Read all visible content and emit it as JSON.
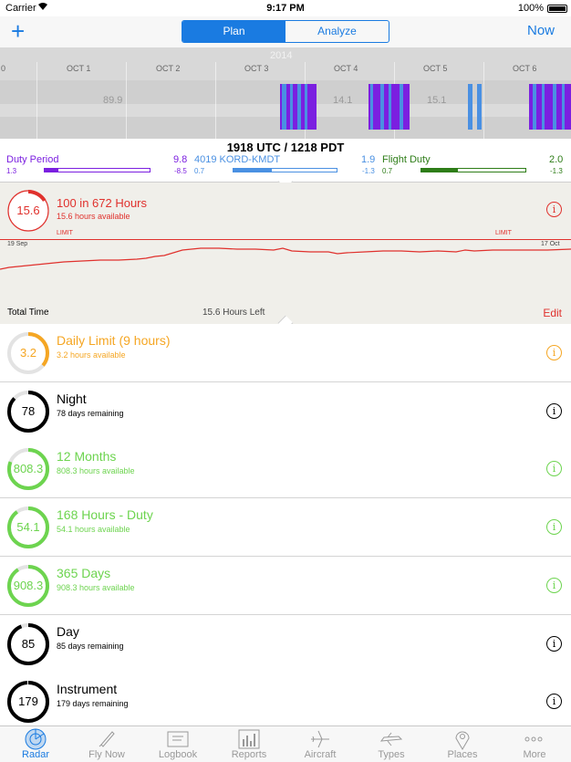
{
  "status_bar": {
    "carrier": "Carrier",
    "time": "9:17 PM",
    "battery": "100%"
  },
  "nav": {
    "segments": [
      "Plan",
      "Analyze"
    ],
    "active_segment": "Plan",
    "right_button": "Now",
    "left_icon": "plus-icon"
  },
  "timeline": {
    "year": "2014",
    "days": [
      "0",
      "OCT 1",
      "OCT 2",
      "OCT 3",
      "OCT 4",
      "OCT 5",
      "OCT 6"
    ],
    "hour_values": [
      "89.9",
      "14.1",
      "15.1"
    ],
    "colors": {
      "duty": "#7b1fe0",
      "flight": "#4a90e2"
    }
  },
  "info": {
    "utc_pdt": "1918 UTC / 1218 PDT",
    "duty_period": {
      "label": "Duty Period",
      "value": "9.8",
      "left": "1.3",
      "delta": "-8.5",
      "progress": 0.13
    },
    "flight": {
      "label": "4019 KORD-KMDT",
      "value": "1.9",
      "left": "0.7",
      "delta": "-1.3",
      "progress": 0.37
    },
    "flight_duty": {
      "label": "Flight Duty",
      "value": "2.0",
      "left": "0.7",
      "delta": "-1.3",
      "progress": 0.35
    }
  },
  "total": {
    "ring_value": "15.6",
    "ring_progress": 0.16,
    "title": "100 in 672 Hours",
    "subtitle": "15.6 hours available",
    "limit_left": "LIMIT",
    "limit_right": "LIMIT",
    "start_date": "19 Sep",
    "end_date": "17 Oct",
    "footer_left": "Total Time",
    "footer_center": "15.6 Hours Left",
    "edit": "Edit",
    "color": "#e0312d"
  },
  "rows": [
    {
      "value": "3.2",
      "title": "Daily Limit (9 hours)",
      "subtitle": "3.2 hours available",
      "color": "#f5a623",
      "progress": 0.36
    },
    {
      "value": "78",
      "title": "Night",
      "subtitle": "78 days remaining",
      "color": "#000000",
      "progress": 0.87
    },
    {
      "value": "808.3",
      "title": "12 Months",
      "subtitle": "808.3 hours available",
      "color": "#6dd44f",
      "progress": 0.81
    },
    {
      "value": "54.1",
      "title": "168 Hours - Duty",
      "subtitle": "54.1 hours available",
      "color": "#6dd44f",
      "progress": 0.9
    },
    {
      "value": "908.3",
      "title": "365 Days",
      "subtitle": "908.3 hours available",
      "color": "#6dd44f",
      "progress": 0.91
    },
    {
      "value": "85",
      "title": "Day",
      "subtitle": "85 days remaining",
      "color": "#000000",
      "progress": 0.94
    },
    {
      "value": "179",
      "title": "Instrument",
      "subtitle": "179 days remaining",
      "color": "#000000",
      "progress": 0.99
    }
  ],
  "tabs": [
    {
      "label": "Radar",
      "icon": "radar-icon",
      "active": true
    },
    {
      "label": "Fly Now",
      "icon": "rocket-icon"
    },
    {
      "label": "Logbook",
      "icon": "logbook-icon"
    },
    {
      "label": "Reports",
      "icon": "bar-chart-icon"
    },
    {
      "label": "Aircraft",
      "icon": "airplane-icon"
    },
    {
      "label": "Types",
      "icon": "jet-icon"
    },
    {
      "label": "Places",
      "icon": "map-pin-icon"
    },
    {
      "label": "More",
      "icon": "more-icon"
    }
  ]
}
